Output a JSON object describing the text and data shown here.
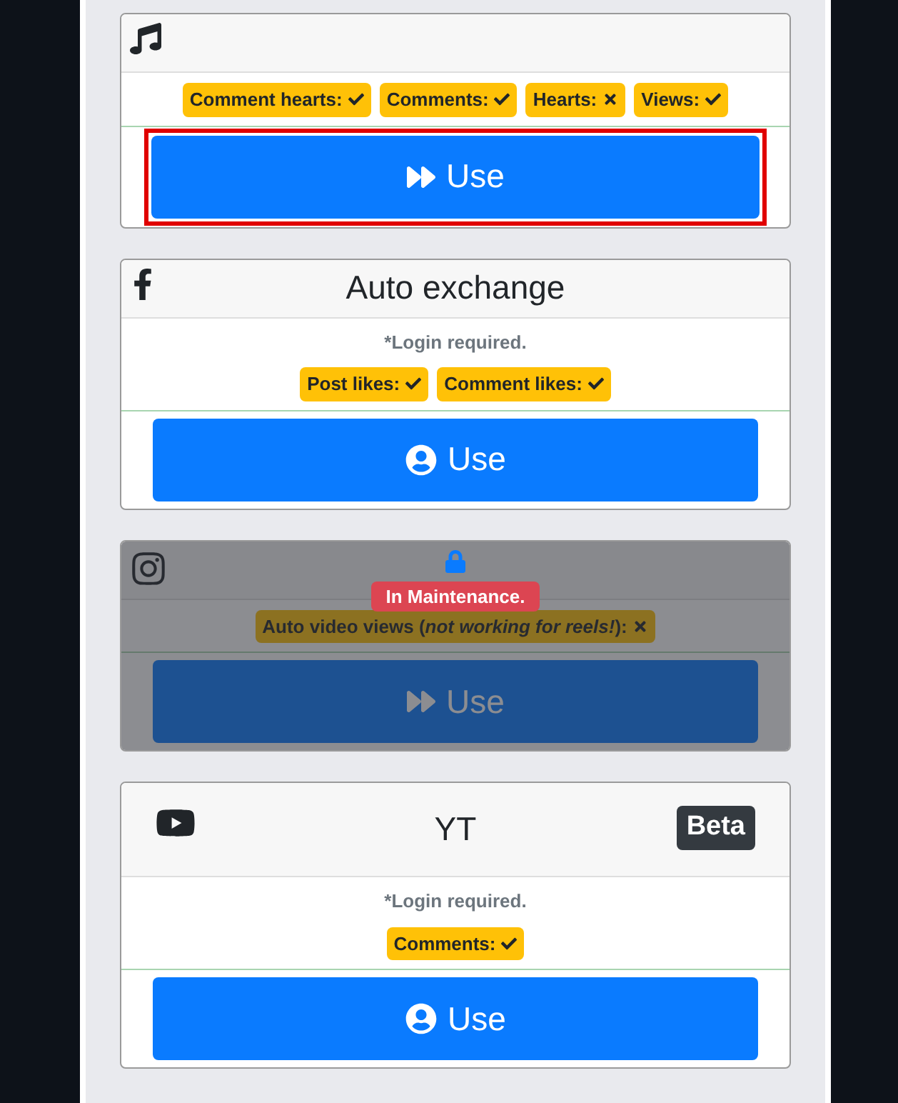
{
  "cards": [
    {
      "tags": [
        {
          "label": "Comment hearts:",
          "ok": true
        },
        {
          "label": "Comments:",
          "ok": true
        },
        {
          "label": "Hearts:",
          "ok": false
        },
        {
          "label": "Views:",
          "ok": true
        }
      ],
      "button": {
        "label": "Use",
        "kind": "direct",
        "highlighted": true
      },
      "maintenance": false
    },
    {
      "title": "Auto exchange",
      "note": "*Login required.",
      "tags": [
        {
          "label": "Post likes:",
          "ok": true
        },
        {
          "label": "Comment likes:",
          "ok": true
        }
      ],
      "button": {
        "label": "Use",
        "kind": "login",
        "highlighted": false
      },
      "maintenance": false
    },
    {
      "tags": [
        {
          "label": "Auto video views (*not working for reels!*):",
          "ok": false
        }
      ],
      "button": {
        "label": "Use",
        "kind": "direct",
        "highlighted": false
      },
      "maintenance": true,
      "maintenance_label": "In Maintenance."
    },
    {
      "title": "YT",
      "badge": "Beta",
      "note": "*Login required.",
      "tags": [
        {
          "label": "Comments:",
          "ok": true
        }
      ],
      "button": {
        "label": "Use",
        "kind": "login",
        "highlighted": false
      },
      "maintenance": false
    }
  ]
}
